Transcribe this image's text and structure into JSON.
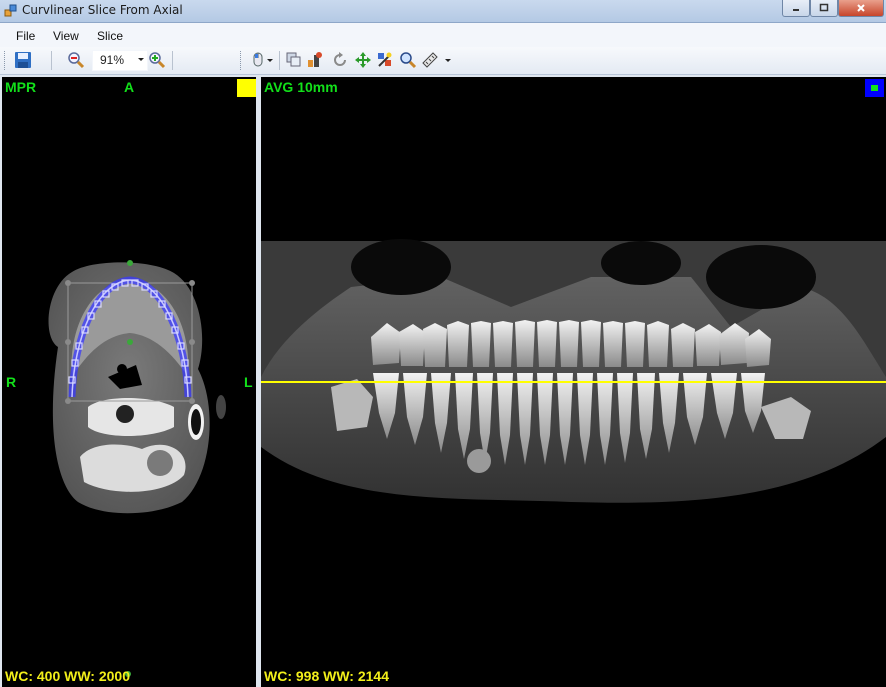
{
  "window": {
    "title": "Curvlinear Slice From Axial"
  },
  "menu": {
    "file": "File",
    "view": "View",
    "slice": "Slice"
  },
  "toolbar": {
    "zoom_value": "91%"
  },
  "left_panel": {
    "label": "MPR",
    "orientation_top": "A",
    "orientation_left": "R",
    "orientation_right": "L",
    "window_level": "WC: 400 WW: 2000",
    "indicator_color": "#ffff00"
  },
  "right_panel": {
    "label": "AVG 10mm",
    "window_level": "WC: 998 WW: 2144",
    "indicator_color": "#0000ff",
    "slice_line_color": "#ffff00"
  },
  "colors": {
    "overlay_text": "#12e01a",
    "wl_text": "#f2ef1a",
    "curve": "#3a3aff"
  }
}
